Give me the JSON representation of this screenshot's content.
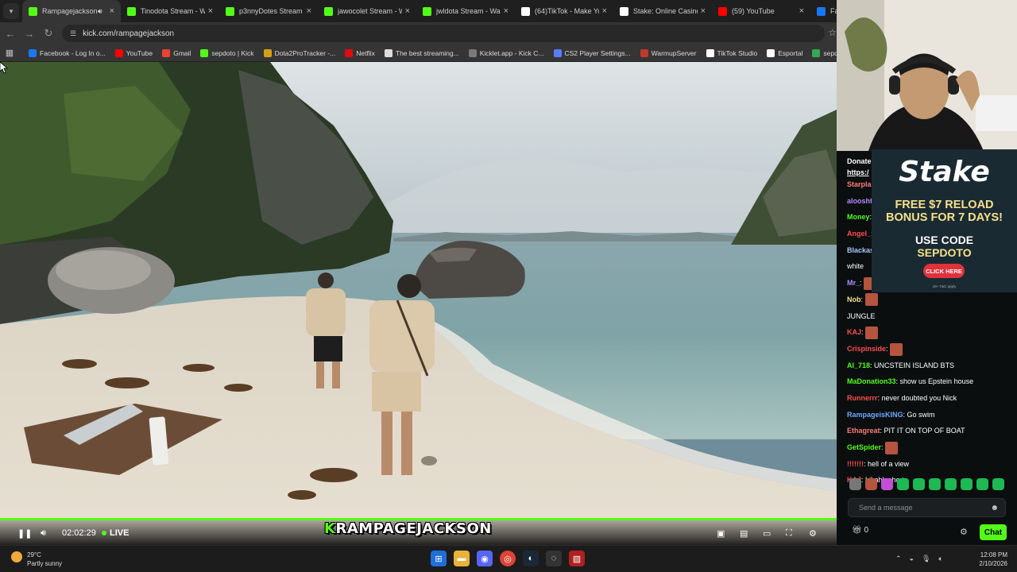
{
  "browser": {
    "tabs": [
      {
        "title": "Rampagejackson",
        "active": true,
        "favicon_color": "#53fc18"
      },
      {
        "title": "Tinodota Stream - W",
        "active": false,
        "favicon_color": "#53fc18"
      },
      {
        "title": "p3nnyDotes Stream",
        "active": false,
        "favicon_color": "#53fc18"
      },
      {
        "title": "jawocolet Stream - W",
        "active": false,
        "favicon_color": "#53fc18"
      },
      {
        "title": "jwldota Stream - Wa",
        "active": false,
        "favicon_color": "#53fc18"
      },
      {
        "title": "(64)TikTok - Make Yo",
        "active": false,
        "favicon_color": "#ffffff"
      },
      {
        "title": "Stake: Online Casino",
        "active": false,
        "favicon_color": "#ffffff"
      },
      {
        "title": "(59) YouTube",
        "active": false,
        "favicon_color": "#ff0000"
      },
      {
        "title": "Faceb",
        "active": false,
        "favicon_color": "#1877f2"
      }
    ],
    "url": "kick.com/rampagejackson",
    "bookmarks": [
      {
        "label": "Facebook - Log In o...",
        "color": "#1877f2"
      },
      {
        "label": "YouTube",
        "color": "#ff0000"
      },
      {
        "label": "Gmail",
        "color": "#ea4335"
      },
      {
        "label": "sepdoto | Kick",
        "color": "#53fc18"
      },
      {
        "label": "Dota2ProTracker -...",
        "color": "#d4a017"
      },
      {
        "label": "Netflix",
        "color": "#e50914"
      },
      {
        "label": "The best streaming...",
        "color": "#dddddd"
      },
      {
        "label": "Kicklet.app - Kick C...",
        "color": "#7a7a7a"
      },
      {
        "label": "CS2 Player Settings...",
        "color": "#5b7cfa"
      },
      {
        "label": "WarmupServer",
        "color": "#c0392b"
      },
      {
        "label": "TikTok Studio",
        "color": "#ffffff"
      },
      {
        "label": "Esportal",
        "color": "#ffffff"
      },
      {
        "label": "sepdotes | Weig",
        "color": "#34a853"
      }
    ]
  },
  "player": {
    "elapsed": "02:02:29",
    "live_label": "LIVE",
    "overlay_k": "K",
    "overlay_name": "RAMPAGEJACKSON",
    "accent": "#53fc18"
  },
  "ad": {
    "brand": "Stake",
    "line1": "FREE $7 RELOAD",
    "line2": "BONUS FOR 7 DAYS!",
    "line3": "USE CODE",
    "line4": "SEPDOTO",
    "button": "CLICK HERE",
    "fine_print": "18+ T&C apply"
  },
  "chat": {
    "donate_label": "Donate",
    "donate_link": "https:/",
    "messages": [
      {
        "user": "Starpla",
        "text": "",
        "color": "#ff7b7b"
      },
      {
        "user": "aloosht",
        "text": "",
        "color": "#b18cff"
      },
      {
        "user": "Money",
        "text": "",
        "color": "#53fc18"
      },
      {
        "user": "Angel_",
        "text": "",
        "color": "#ff4d4d"
      },
      {
        "user": "Blackas",
        "text": "",
        "color": "#a9c6ff"
      },
      {
        "user": "",
        "text": "white",
        "color": "#ffffff"
      },
      {
        "user": "Mr_",
        "text": "",
        "color": "#b18cff"
      },
      {
        "user": "Nob",
        "text": "",
        "color": "#f6e08a"
      },
      {
        "user": "",
        "text": "JUNGLE",
        "color": "#ffffff"
      },
      {
        "user": "KAJ",
        "text": "",
        "color": "#ff4d4d"
      },
      {
        "user": "Crispinside",
        "text": "",
        "color": "#ff4d4d"
      },
      {
        "user": "AI_718",
        "text": "UNCSTEIN ISLAND BTS",
        "color": "#53fc18"
      },
      {
        "user": "MaDonation33",
        "text": "show us Epstein house",
        "color": "#53fc18"
      },
      {
        "user": "Runnerrr",
        "text": "never doubted you Nick",
        "color": "#ff4d4d"
      },
      {
        "user": "RampageisKING",
        "text": "Go swim",
        "color": "#6ea8ff"
      },
      {
        "user": "Ethagreat",
        "text": "PIT IT ON TOP OF BOAT",
        "color": "#ff7b7b"
      },
      {
        "user": "GetSpider",
        "text": "",
        "color": "#53fc18"
      },
      {
        "user": "!!!!!!!",
        "text": "hell of a view",
        "color": "#ff4d4d"
      },
      {
        "user": "KAJ",
        "text": "Lil ahh shorts",
        "color": "#ff4d4d"
      }
    ],
    "input_placeholder": "Send a message",
    "gift_count": "0",
    "send_label": "Chat"
  },
  "taskbar": {
    "temperature": "29°C",
    "condition": "Partly sunny",
    "time": "12:08 PM",
    "date": "2/10/2026"
  }
}
